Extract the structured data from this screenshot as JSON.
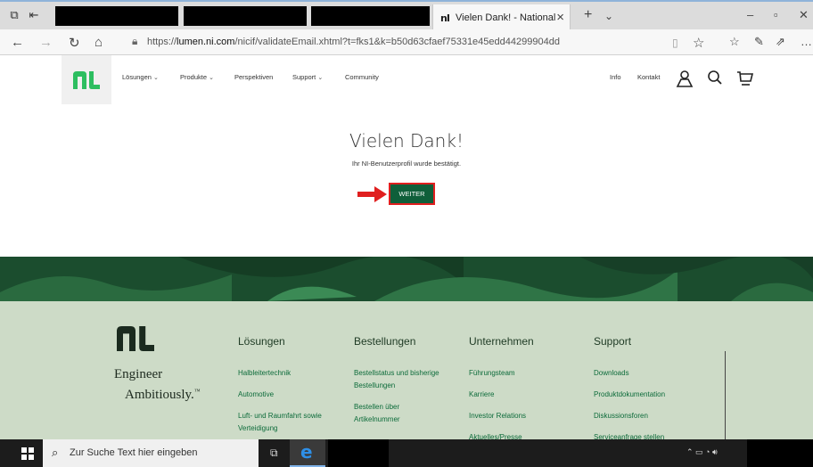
{
  "browser": {
    "tab_title": "Vielen Dank! - National",
    "url_prefix": "https://",
    "url_domain": "lumen.ni.com",
    "url_path": "/nicif/validateEmail.xhtml?t=fks1&k=b50d63cfaef75331e45edd44299904dd"
  },
  "site_nav": {
    "items": [
      {
        "label": "Lösungen",
        "has_dropdown": true
      },
      {
        "label": "Produkte",
        "has_dropdown": true
      },
      {
        "label": "Perspektiven",
        "has_dropdown": false
      },
      {
        "label": "Support",
        "has_dropdown": true
      },
      {
        "label": "Community",
        "has_dropdown": false
      }
    ],
    "right_links": [
      "Info",
      "Kontakt"
    ],
    "icons": [
      "account-icon",
      "search-icon",
      "cart-icon"
    ]
  },
  "content": {
    "title": "Vielen Dank!",
    "subtitle": "Ihr NI-Benutzerprofil wurde bestätigt.",
    "button_label": "WEITER"
  },
  "footer": {
    "slogan_line1": "Engineer",
    "slogan_line2": "Ambitiously.",
    "slogan_tm": "™",
    "columns": [
      {
        "heading": "Lösungen",
        "links": [
          "Halbleitertechnik",
          "Automotive",
          "Luft- und Raumfahrt sowie Verteidigung"
        ]
      },
      {
        "heading": "Bestellungen",
        "links": [
          "Bestellstatus und bisherige Bestellungen",
          "Bestellen über Artikelnummer"
        ]
      },
      {
        "heading": "Unternehmen",
        "links": [
          "Führungsteam",
          "Karriere",
          "Investor Relations",
          "Aktuelles/Presse"
        ]
      },
      {
        "heading": "Support",
        "links": [
          "Downloads",
          "Produktdokumentation",
          "Diskussionsforen",
          "Serviceanfrage stellen"
        ]
      }
    ]
  },
  "taskbar": {
    "search_placeholder": "Zur Suche Text hier eingeben"
  },
  "colors": {
    "brand_green": "#0f5f3a",
    "footer_bg": "#cddbc7",
    "highlight_red": "#e01f1f"
  }
}
